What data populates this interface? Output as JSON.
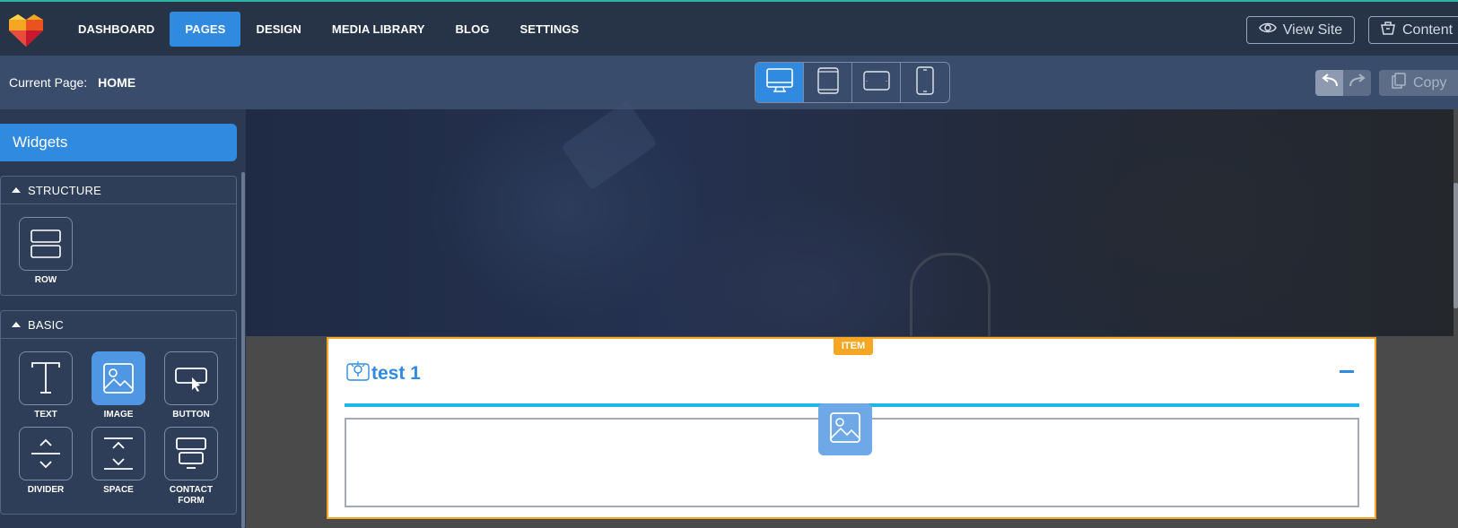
{
  "topbar": {
    "nav": [
      {
        "label": "DASHBOARD",
        "active": false
      },
      {
        "label": "PAGES",
        "active": true
      },
      {
        "label": "DESIGN",
        "active": false
      },
      {
        "label": "MEDIA LIBRARY",
        "active": false
      },
      {
        "label": "BLOG",
        "active": false
      },
      {
        "label": "SETTINGS",
        "active": false
      }
    ],
    "view_site_label": "View Site",
    "content_label": "Content"
  },
  "subbar": {
    "current_page_label": "Current Page:",
    "current_page_value": "HOME",
    "devices": [
      "desktop-icon",
      "tablet-icon",
      "tablet-landscape-icon",
      "mobile-icon"
    ],
    "active_device": "desktop",
    "copy_label": "Copy"
  },
  "sidebar": {
    "title": "Widgets",
    "structure": {
      "heading": "STRUCTURE",
      "widgets": [
        {
          "label": "ROW",
          "icon": "row-icon"
        }
      ]
    },
    "basic": {
      "heading": "BASIC",
      "widgets": [
        {
          "label": "TEXT",
          "icon": "text-icon"
        },
        {
          "label": "IMAGE",
          "icon": "image-icon",
          "active": true
        },
        {
          "label": "BUTTON",
          "icon": "button-icon"
        },
        {
          "label": "DIVIDER",
          "icon": "divider-icon"
        },
        {
          "label": "SPACE",
          "icon": "space-icon"
        },
        {
          "label": "CONTACT FORM",
          "icon": "contact-form-icon"
        }
      ]
    }
  },
  "canvas": {
    "item_badge": "ITEM",
    "item_title": "test 1"
  },
  "colors": {
    "accent": "#2f8ae0",
    "item_border": "#f5a623",
    "underline": "#1fb4ea"
  }
}
